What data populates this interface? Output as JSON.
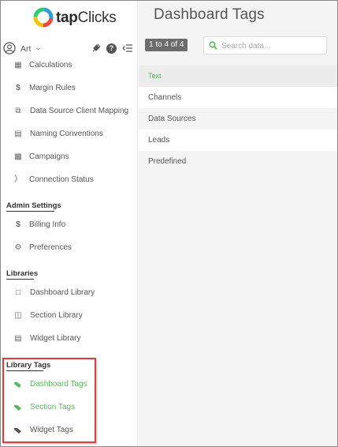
{
  "logo": {
    "brand_prefix": "tap",
    "brand_suffix": "Clicks"
  },
  "user": {
    "name": "Art"
  },
  "sidebar": {
    "top_items": [
      {
        "label": "Calculations",
        "icon": "calculator-icon"
      },
      {
        "label": "Margin Rules",
        "icon": "dollar-icon"
      },
      {
        "label": "Data Source Client Mapping",
        "icon": "copy-icon"
      },
      {
        "label": "Naming Conventions",
        "icon": "document-icon"
      },
      {
        "label": "Campaigns",
        "icon": "briefcase-icon"
      },
      {
        "label": "Connection Status",
        "icon": "plug-icon"
      }
    ],
    "admin_heading": "Admin Settings",
    "admin_items": [
      {
        "label": "Billing Info",
        "icon": "dollar-icon"
      },
      {
        "label": "Preferences",
        "icon": "gears-icon"
      }
    ],
    "libraries_heading": "Libraries",
    "library_items": [
      {
        "label": "Dashboard Library",
        "icon": "window-icon"
      },
      {
        "label": "Section Library",
        "icon": "columns-icon"
      },
      {
        "label": "Widget Library",
        "icon": "list-icon"
      }
    ],
    "library_tags_heading": "Library Tags",
    "library_tag_items": [
      {
        "label": "Dashboard Tags",
        "icon": "tags-icon",
        "active": true
      },
      {
        "label": "Section Tags",
        "icon": "tags-icon",
        "active": true
      },
      {
        "label": "Widget Tags",
        "icon": "tags-icon",
        "active": false
      }
    ]
  },
  "main": {
    "title": "Dashboard Tags",
    "pager": "1 to 4 of 4",
    "search_placeholder": "Search data...",
    "column_header": "Text",
    "rows": [
      "Channels",
      "Data Sources",
      "Leads",
      "Predefined"
    ]
  },
  "colors": {
    "accent_green": "#5cb85c",
    "highlight_red": "#e03c3c",
    "pager_bg": "#6c6c6c"
  }
}
